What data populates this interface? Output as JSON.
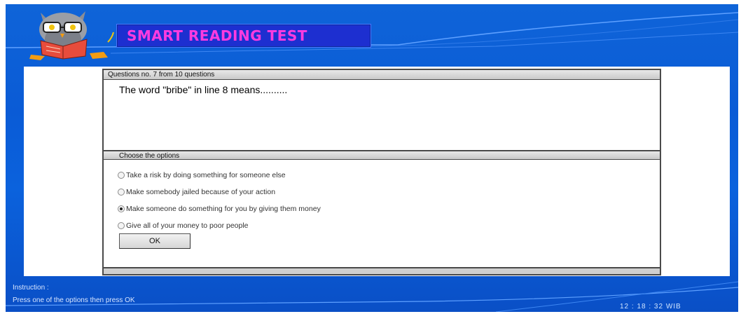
{
  "header": {
    "title": "SMART READING TEST"
  },
  "question": {
    "counter": "Questions no. 7 from 10 questions",
    "text": "The word \"bribe\" in line 8 means.........."
  },
  "options": {
    "heading": "Choose the options",
    "items": [
      {
        "label": "Take a risk by doing something for someone else",
        "selected": false
      },
      {
        "label": "Make somebody jailed because of your action",
        "selected": false
      },
      {
        "label": "Make someone do something for you by giving them money",
        "selected": true
      },
      {
        "label": "Give all of your money to poor people",
        "selected": false
      }
    ],
    "ok_label": "OK"
  },
  "footer": {
    "instruction_label": "Instruction :",
    "instruction_text": "Press one of the options then press OK",
    "clock": "12 : 18 : 32  WIB"
  },
  "colors": {
    "background_blue": "#0a5bd6",
    "title_text": "#ff3be0",
    "title_box": "#1d2fd0"
  },
  "icons": {
    "mascot": "owl-reading-book-icon"
  }
}
